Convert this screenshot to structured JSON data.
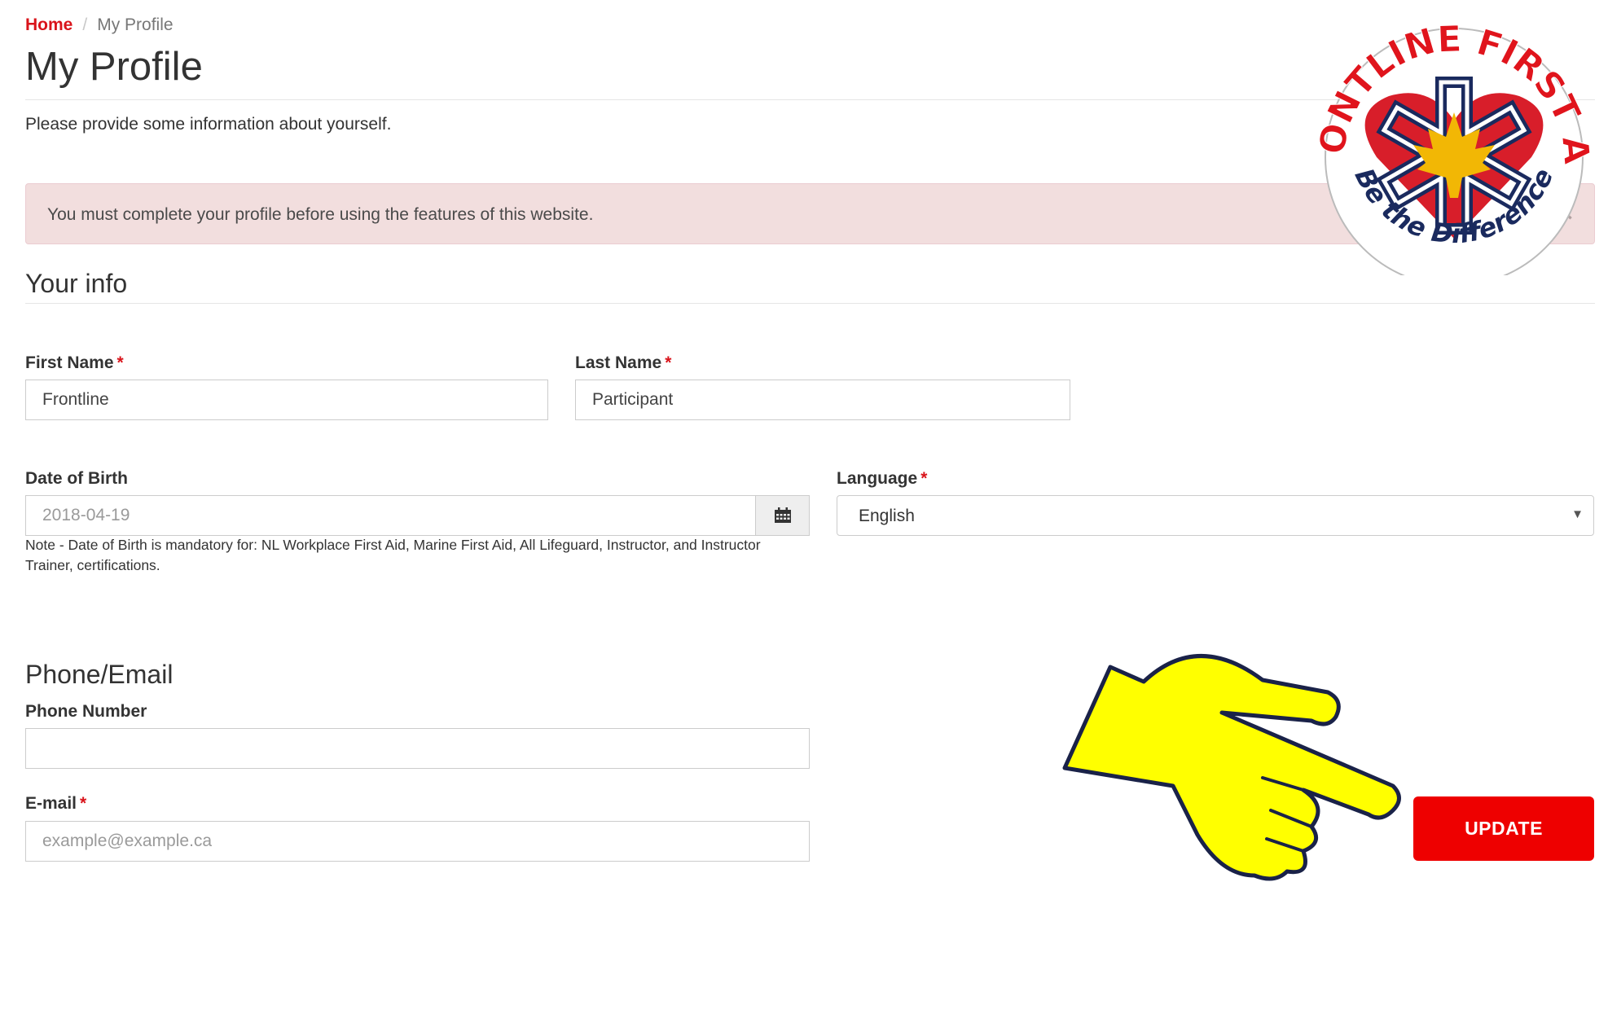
{
  "breadcrumb": {
    "home": "Home",
    "separator": "/",
    "current": "My Profile"
  },
  "page": {
    "title": "My Profile",
    "intro": "Please provide some information about yourself."
  },
  "alert": {
    "message": "You must complete your profile before using the features of this website.",
    "close": "×"
  },
  "your_info": {
    "heading": "Your info",
    "first_name": {
      "label": "First Name",
      "required": "*",
      "value": "Frontline"
    },
    "last_name": {
      "label": "Last Name",
      "required": "*",
      "value": "Participant"
    },
    "dob": {
      "label": "Date of Birth",
      "placeholder": "2018-04-19",
      "value": "",
      "note": "Note - Date of Birth is mandatory for: NL Workplace First Aid, Marine First Aid, All Lifeguard, Instructor, and Instructor Trainer, certifications.",
      "icon": "calendar-icon"
    },
    "language": {
      "label": "Language",
      "required": "*",
      "selected": "English",
      "caret": "▼"
    }
  },
  "phone_email": {
    "heading": "Phone/Email",
    "phone": {
      "label": "Phone Number",
      "value": ""
    },
    "email": {
      "label": "E-mail",
      "required": "*",
      "placeholder": "example@example.ca",
      "value": ""
    }
  },
  "actions": {
    "update": "UPDATE"
  },
  "logo": {
    "top_text": "FRONTLINE FIRST AID",
    "bottom_text": "Be the Difference"
  },
  "colors": {
    "brand_red": "#ee0000",
    "link_red": "#d9141b",
    "alert_bg": "#f2dede",
    "pointer_yellow": "#ffff00",
    "logo_navy": "#1a2a5e"
  }
}
